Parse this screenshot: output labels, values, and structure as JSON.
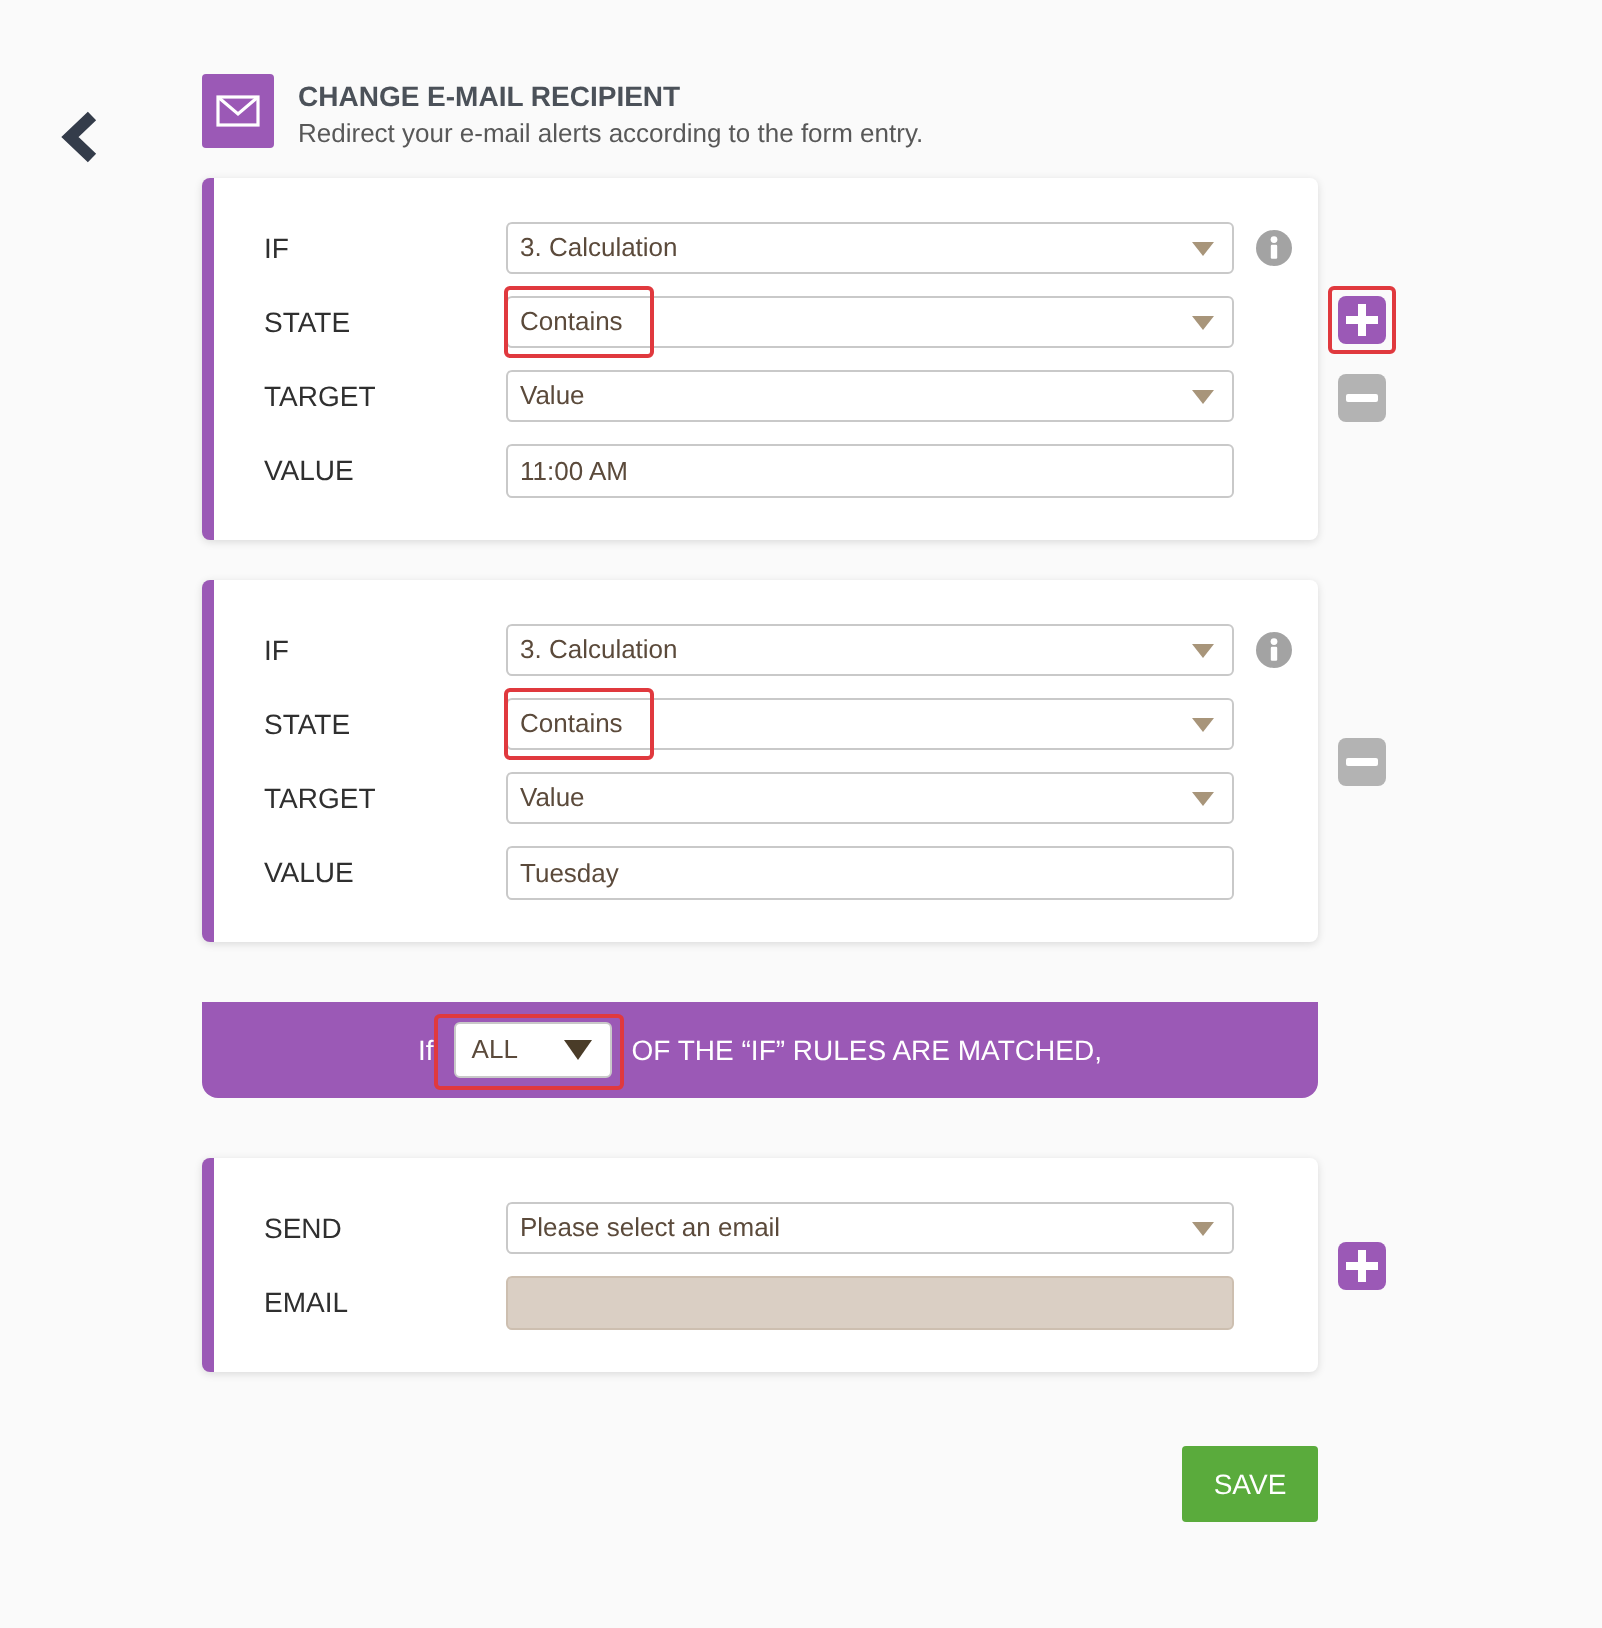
{
  "header": {
    "title": "CHANGE E-MAIL RECIPIENT",
    "subtitle": "Redirect your e-mail alerts according to the form entry."
  },
  "conditions": [
    {
      "fields": [
        {
          "label": "IF",
          "kind": "select",
          "value": "3. Calculation",
          "highlighted": false
        },
        {
          "label": "STATE",
          "kind": "select",
          "value": "Contains",
          "highlighted": true
        },
        {
          "label": "TARGET",
          "kind": "select",
          "value": "Value",
          "highlighted": false
        },
        {
          "label": "VALUE",
          "kind": "input",
          "value": "11:00 AM",
          "highlighted": false
        }
      ],
      "buttons": [
        {
          "kind": "add",
          "highlighted": true
        },
        {
          "kind": "remove",
          "highlighted": false
        }
      ]
    },
    {
      "fields": [
        {
          "label": "IF",
          "kind": "select",
          "value": "3. Calculation",
          "highlighted": false
        },
        {
          "label": "STATE",
          "kind": "select",
          "value": "Contains",
          "highlighted": true
        },
        {
          "label": "TARGET",
          "kind": "select",
          "value": "Value",
          "highlighted": false
        },
        {
          "label": "VALUE",
          "kind": "input",
          "value": "Tuesday",
          "highlighted": false
        }
      ],
      "buttons": [
        {
          "kind": "remove",
          "highlighted": false
        }
      ]
    }
  ],
  "match": {
    "prefix": "If",
    "value": "ALL",
    "highlighted": true,
    "suffix": "OF THE “IF” RULES ARE MATCHED,"
  },
  "action": {
    "fields": [
      {
        "label": "SEND",
        "kind": "select",
        "value": "Please select an email",
        "disabled": false
      },
      {
        "label": "EMAIL",
        "kind": "input",
        "disabled": true
      }
    ],
    "buttons": [
      {
        "kind": "add",
        "highlighted": false
      }
    ]
  },
  "save_button": {
    "label": "SAVE"
  }
}
